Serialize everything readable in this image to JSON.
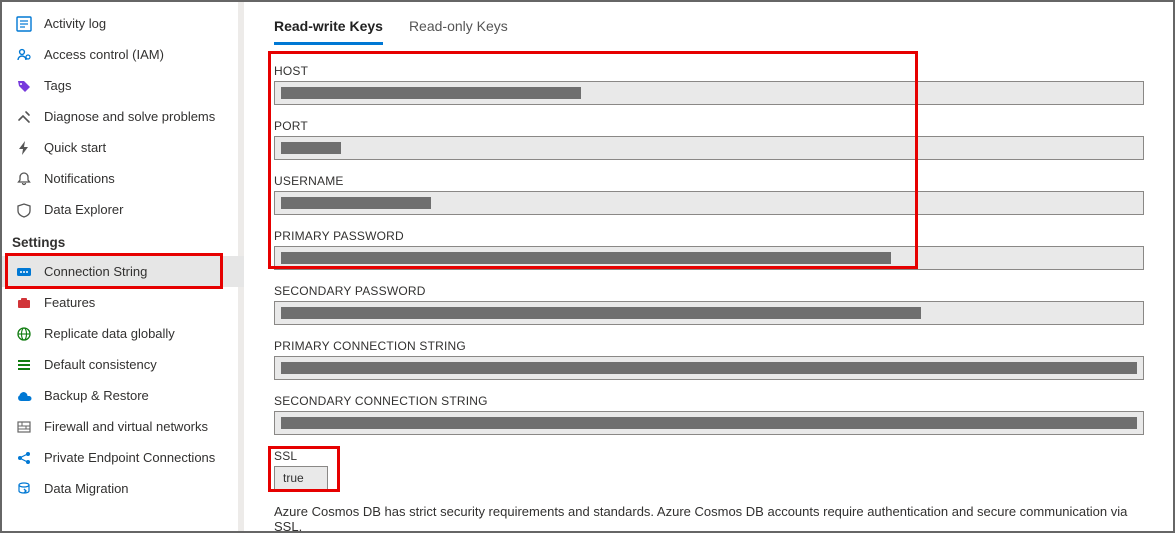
{
  "sidebar": {
    "top_items": [
      {
        "label": "Activity log",
        "icon": "activity-log-icon",
        "color": "#0078d4"
      },
      {
        "label": "Access control (IAM)",
        "icon": "access-control-icon",
        "color": "#0078d4"
      },
      {
        "label": "Tags",
        "icon": "tags-icon",
        "color": "#773adc"
      },
      {
        "label": "Diagnose and solve problems",
        "icon": "diagnose-icon",
        "color": "#555"
      },
      {
        "label": "Quick start",
        "icon": "quick-start-icon",
        "color": "#555"
      },
      {
        "label": "Notifications",
        "icon": "notifications-icon",
        "color": "#555"
      },
      {
        "label": "Data Explorer",
        "icon": "data-explorer-icon",
        "color": "#555"
      }
    ],
    "section_label": "Settings",
    "settings_items": [
      {
        "label": "Connection String",
        "icon": "connection-string-icon",
        "color": "#0078d4",
        "selected": true
      },
      {
        "label": "Features",
        "icon": "features-icon",
        "color": "#d13438"
      },
      {
        "label": "Replicate data globally",
        "icon": "globe-icon",
        "color": "#107c10"
      },
      {
        "label": "Default consistency",
        "icon": "consistency-icon",
        "color": "#107c10"
      },
      {
        "label": "Backup & Restore",
        "icon": "backup-icon",
        "color": "#0078d4"
      },
      {
        "label": "Firewall and virtual networks",
        "icon": "firewall-icon",
        "color": "#666"
      },
      {
        "label": "Private Endpoint Connections",
        "icon": "endpoint-icon",
        "color": "#0078d4"
      },
      {
        "label": "Data Migration",
        "icon": "migration-icon",
        "color": "#0078d4"
      }
    ]
  },
  "tabs": {
    "read_write": "Read-write Keys",
    "read_only": "Read-only Keys"
  },
  "fields": {
    "host": {
      "label": "HOST"
    },
    "port": {
      "label": "PORT"
    },
    "username": {
      "label": "USERNAME"
    },
    "primary_password": {
      "label": "PRIMARY PASSWORD"
    },
    "secondary_password": {
      "label": "SECONDARY PASSWORD"
    },
    "primary_conn": {
      "label": "PRIMARY CONNECTION STRING"
    },
    "secondary_conn": {
      "label": "SECONDARY CONNECTION STRING"
    },
    "ssl": {
      "label": "SSL",
      "value": "true"
    }
  },
  "footer_note": "Azure Cosmos DB has strict security requirements and standards. Azure Cosmos DB accounts require authentication and secure communication via SSL."
}
